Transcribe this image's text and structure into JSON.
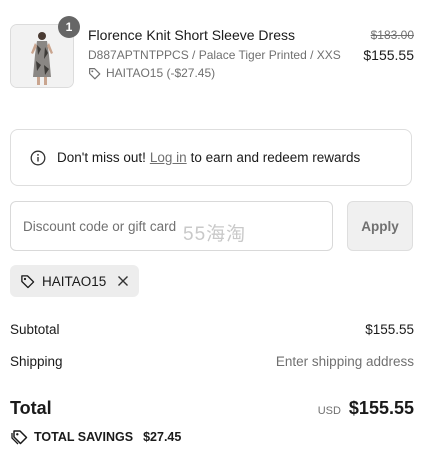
{
  "line_item": {
    "quantity": "1",
    "title": "Florence Knit Short Sleeve Dress",
    "variant": "D887APTNTPPCS / Palace Tiger Printed / XXS",
    "discount": "HAITAO15 (-$27.45)",
    "original_price": "$183.00",
    "price": "$155.55"
  },
  "login_banner": {
    "prefix": "Don't miss out!",
    "link": "Log in",
    "suffix": "to earn and redeem rewards",
    "icon": "info-icon"
  },
  "discount_form": {
    "placeholder": "Discount code or gift card",
    "apply_label": "Apply",
    "watermark": "55海淘"
  },
  "applied_code": {
    "code": "HAITAO15",
    "icon": "tag-icon",
    "remove_icon": "close-icon"
  },
  "summary": {
    "subtotal_label": "Subtotal",
    "subtotal_value": "$155.55",
    "shipping_label": "Shipping",
    "shipping_value": "Enter shipping address",
    "total_label": "Total",
    "currency": "USD",
    "total_value": "$155.55",
    "savings_label": "TOTAL SAVINGS",
    "savings_value": "$27.45"
  },
  "colors": {
    "text": "#1a1a1a",
    "muted": "#707070",
    "border": "#dedede",
    "button_bg": "#f0f0f0",
    "badge_bg": "#666666"
  }
}
